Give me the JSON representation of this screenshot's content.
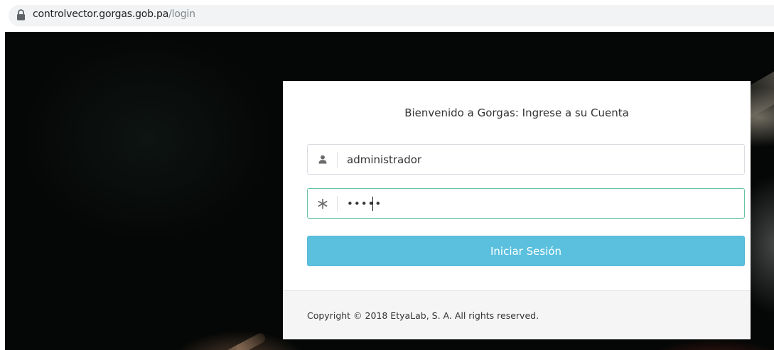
{
  "browser": {
    "url_host": "controlvector.gorgas.gob.pa",
    "url_path": "/login",
    "lock_icon": "lock-icon"
  },
  "login": {
    "title": "Bienvenido a Gorgas: Ingrese a su Cuenta",
    "username_value": "administrador",
    "username_icon": "user-icon",
    "password_value": "•••••",
    "password_icon": "asterisk-icon",
    "submit_label": "Iniciar Sesión",
    "footer_text": "Copyright © 2018 EtyaLab, S. A. All rights reserved."
  },
  "colors": {
    "button": "#5bc0de",
    "focus_border": "#66c2a5",
    "background": "#060807"
  }
}
